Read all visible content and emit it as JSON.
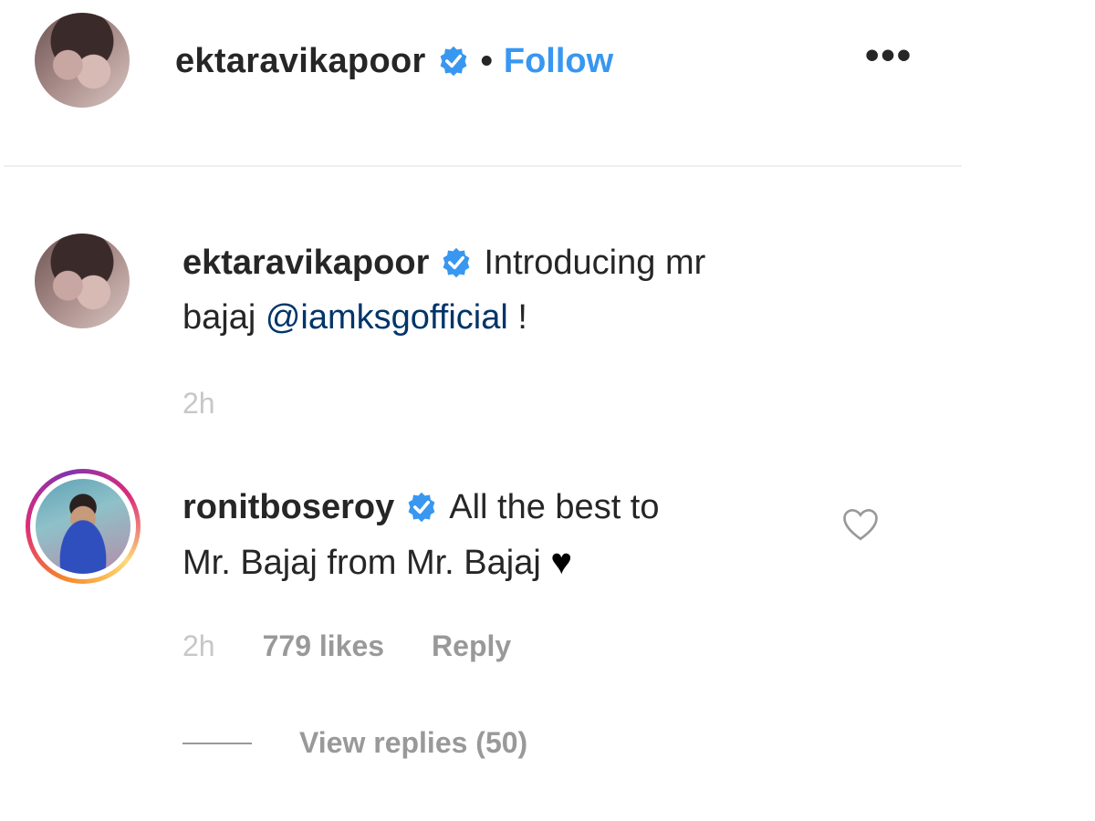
{
  "header": {
    "username": "ektaravikapoor",
    "separator": "•",
    "follow_label": "Follow",
    "more_label": "•••"
  },
  "caption": {
    "username": "ektaravikapoor",
    "text": "Introducing mr",
    "text_line2_prefix": "bajaj ",
    "mention": "@iamksgofficial",
    "text_suffix": " !",
    "time": "2h"
  },
  "comment": {
    "username": "ronitboseroy",
    "text": "All the best to",
    "text_line2": "Mr. Bajaj from Mr. Bajaj",
    "emoji": "♥",
    "time": "2h",
    "likes": "779 likes",
    "reply_label": "Reply",
    "view_replies_label": "View replies (50)"
  },
  "colors": {
    "verified_badge": "#3897f0",
    "follow": "#3897f0",
    "mention": "#003569",
    "meta_text": "#999999"
  },
  "icons": {
    "verified": "verified-badge-icon",
    "more": "more-options-icon",
    "like": "heart-outline-icon"
  }
}
